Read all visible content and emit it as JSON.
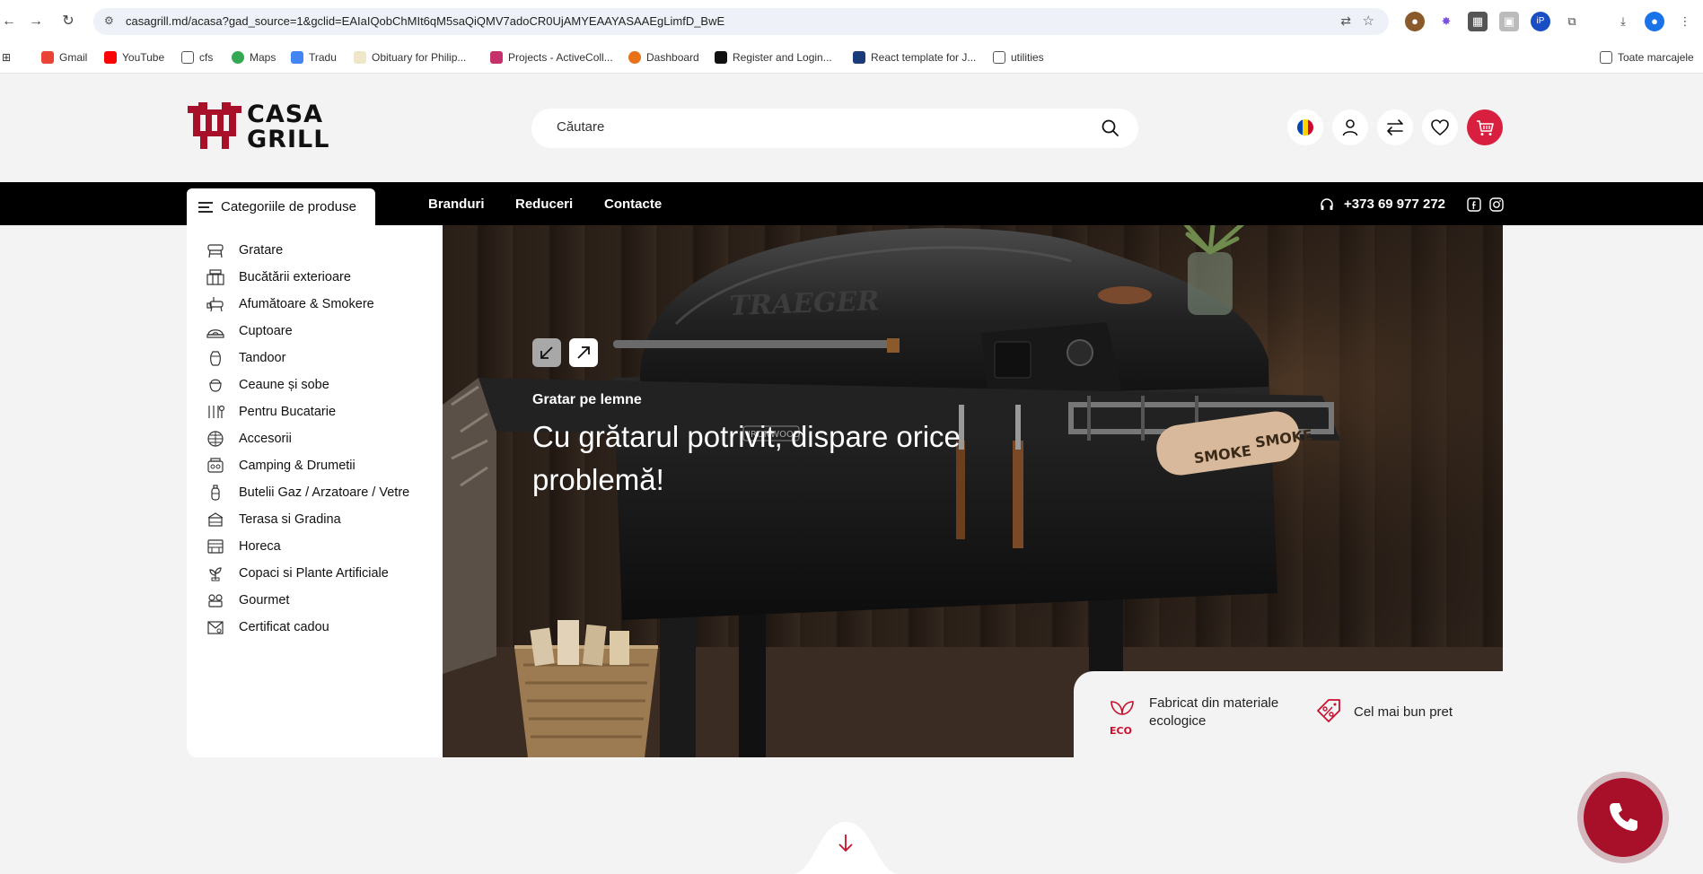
{
  "browser": {
    "url": "casagrill.md/acasa?gad_source=1&gclid=EAIaIQobChMIt6qM5saQiQMV7adoCR0UjAMYEAAYASAAEgLimfD_BwE",
    "bookmarks": [
      "Gmail",
      "YouTube",
      "cfs",
      "Maps",
      "Tradu",
      "Obituary for Philip...",
      "Projects - ActiveColl...",
      "Dashboard",
      "Register and Login...",
      "React template for J...",
      "utilities"
    ],
    "all_bookmarks": "Toate marcajele"
  },
  "header": {
    "logo_line1": "CASA",
    "logo_line2": "GRILL",
    "search_placeholder": "Căutare"
  },
  "nav": {
    "categories": "Categoriile de produse",
    "links": [
      "Branduri",
      "Reduceri",
      "Contacte"
    ],
    "phone": "+373 69 977 272"
  },
  "categories": [
    "Gratare",
    "Bucătării exterioare",
    "Afumătoare & Smokere",
    "Cuptoare",
    "Tandoor",
    "Ceaune și sobe",
    "Pentru Bucatarie",
    "Accesorii",
    "Camping & Drumetii",
    "Butelii Gaz / Arzatoare / Vetre",
    "Terasa si Gradina",
    "Horeca",
    "Copaci si Plante Artificiale",
    "Gourmet",
    "Certificat cadou"
  ],
  "hero": {
    "subtitle": "Gratar pe lemne",
    "title": "Cu grătarul potrivit, dispare orice problemă!",
    "brand_emboss": "TRAEGER",
    "model_badge": "IRONWOOD",
    "towel_text": "SMOKE"
  },
  "features": {
    "eco_badge": "ECO",
    "eco_text": "Fabricat din materiale ecologice",
    "price_text": "Cel mai bun pret"
  },
  "colors": {
    "brand_red": "#c8102e",
    "nav_bg": "#000000",
    "page_bg": "#f4f3f3"
  }
}
